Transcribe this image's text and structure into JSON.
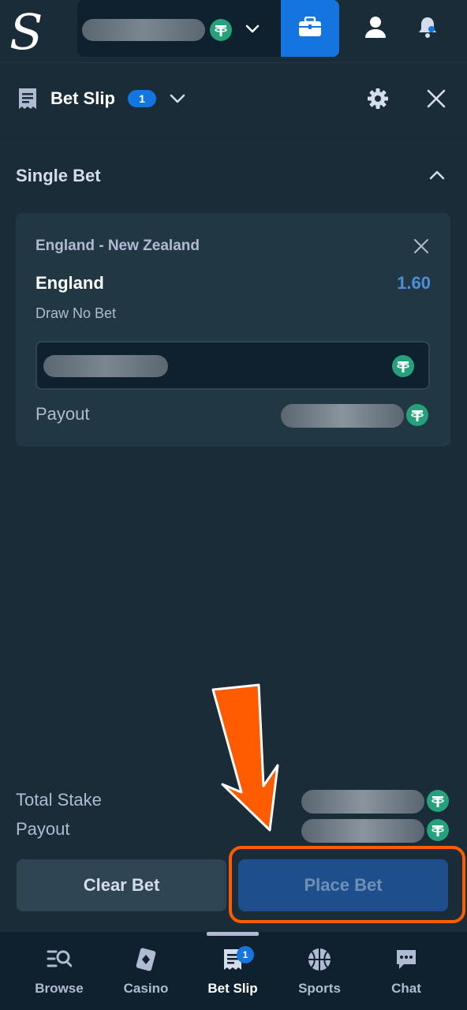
{
  "header": {
    "logo_letter": "S",
    "currency_icon": "tether-coin-icon"
  },
  "betslip": {
    "title": "Bet Slip",
    "count": "1"
  },
  "section": {
    "title": "Single Bet"
  },
  "bet": {
    "event": "England - New Zealand",
    "selection": "England",
    "odds": "1.60",
    "market": "Draw No Bet",
    "payout_label": "Payout"
  },
  "summary": {
    "total_stake_label": "Total Stake",
    "payout_label": "Payout"
  },
  "actions": {
    "clear_label": "Clear Bet",
    "place_label": "Place Bet"
  },
  "nav": [
    {
      "label": "Browse",
      "icon": "browse-icon"
    },
    {
      "label": "Casino",
      "icon": "casino-cards-icon"
    },
    {
      "label": "Bet Slip",
      "icon": "betslip-icon",
      "badge": "1"
    },
    {
      "label": "Sports",
      "icon": "basketball-icon"
    },
    {
      "label": "Chat",
      "icon": "chat-icon"
    }
  ],
  "colors": {
    "background": "#1a2c38",
    "card": "#213743",
    "accent_blue": "#1475e1",
    "odds_blue": "#4d8fd7",
    "tether_green": "#26a17b",
    "annotation_orange": "#ff5b00"
  }
}
